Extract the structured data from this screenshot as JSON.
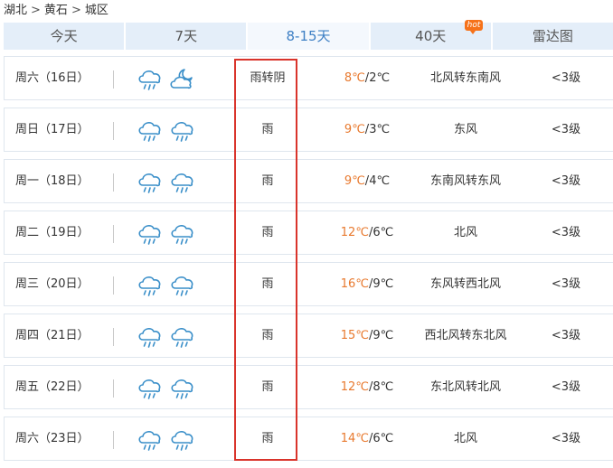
{
  "breadcrumb": [
    "湖北",
    "黄石",
    "城区"
  ],
  "breadcrumb_sep": ">",
  "tabs": [
    {
      "label": "今天"
    },
    {
      "label": "7天"
    },
    {
      "label": "8-15天",
      "active": true
    },
    {
      "label": "40天",
      "badge": "hot"
    },
    {
      "label": "雷达图"
    }
  ],
  "days": [
    {
      "day": "周六（16日）",
      "icons": [
        "rain-cloud-icon",
        "moon-cloud-icon"
      ],
      "weather": "雨转阴",
      "high": "8℃",
      "low": "2℃",
      "wind": "北风转东南风",
      "level": "<3级"
    },
    {
      "day": "周日（17日）",
      "icons": [
        "rain-cloud-icon",
        "rain-cloud-icon"
      ],
      "weather": "雨",
      "high": "9℃",
      "low": "3℃",
      "wind": "东风",
      "level": "<3级"
    },
    {
      "day": "周一（18日）",
      "icons": [
        "rain-cloud-icon",
        "rain-cloud-icon"
      ],
      "weather": "雨",
      "high": "9℃",
      "low": "4℃",
      "wind": "东南风转东风",
      "level": "<3级"
    },
    {
      "day": "周二（19日）",
      "icons": [
        "rain-cloud-icon",
        "rain-cloud-icon"
      ],
      "weather": "雨",
      "high": "12℃",
      "low": "6℃",
      "wind": "北风",
      "level": "<3级"
    },
    {
      "day": "周三（20日）",
      "icons": [
        "rain-cloud-icon",
        "rain-cloud-icon"
      ],
      "weather": "雨",
      "high": "16℃",
      "low": "9℃",
      "wind": "东风转西北风",
      "level": "<3级"
    },
    {
      "day": "周四（21日）",
      "icons": [
        "rain-cloud-icon",
        "rain-cloud-icon"
      ],
      "weather": "雨",
      "high": "15℃",
      "low": "9℃",
      "wind": "西北风转东北风",
      "level": "<3级"
    },
    {
      "day": "周五（22日）",
      "icons": [
        "rain-cloud-icon",
        "rain-cloud-icon"
      ],
      "weather": "雨",
      "high": "12℃",
      "low": "8℃",
      "wind": "东北风转北风",
      "level": "<3级"
    },
    {
      "day": "周六（23日）",
      "icons": [
        "rain-cloud-icon",
        "rain-cloud-icon"
      ],
      "weather": "雨",
      "high": "14℃",
      "low": "6℃",
      "wind": "北风",
      "level": "<3级"
    }
  ],
  "colors": {
    "accent": "#3d7fc4",
    "tab_bg": "#e4eef9",
    "high_temp": "#e8792e",
    "highlight_border": "#d9342b",
    "hot_badge": "#f6721a",
    "icon_stroke": "#3a8fc9"
  }
}
